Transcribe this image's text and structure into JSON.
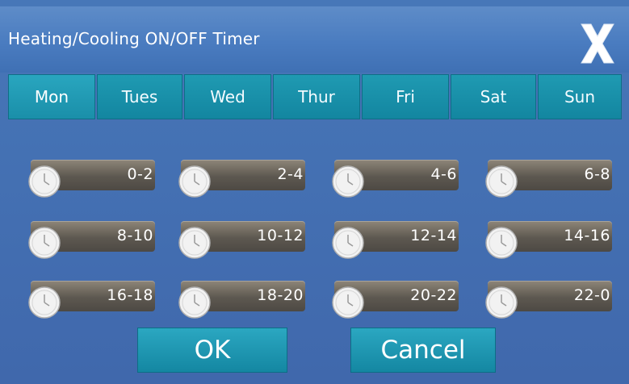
{
  "window": {
    "title": "Heating/Cooling ON/OFF Timer",
    "close_icon": "close-x-icon"
  },
  "days": [
    {
      "label": "Mon",
      "active": true
    },
    {
      "label": "Tues",
      "active": false
    },
    {
      "label": "Wed",
      "active": false
    },
    {
      "label": "Thur",
      "active": false
    },
    {
      "label": "Fri",
      "active": false
    },
    {
      "label": "Sat",
      "active": false
    },
    {
      "label": "Sun",
      "active": false
    }
  ],
  "slots": [
    {
      "label": "0-2",
      "state": "off"
    },
    {
      "label": "2-4",
      "state": "off"
    },
    {
      "label": "4-6",
      "state": "off"
    },
    {
      "label": "6-8",
      "state": "off"
    },
    {
      "label": "8-10",
      "state": "off"
    },
    {
      "label": "10-12",
      "state": "off"
    },
    {
      "label": "12-14",
      "state": "off"
    },
    {
      "label": "14-16",
      "state": "off"
    },
    {
      "label": "16-18",
      "state": "off"
    },
    {
      "label": "18-20",
      "state": "off"
    },
    {
      "label": "20-22",
      "state": "off"
    },
    {
      "label": "22-0",
      "state": "off"
    }
  ],
  "buttons": {
    "ok_label": "OK",
    "cancel_label": "Cancel"
  },
  "colors": {
    "background": "#4470b2",
    "tab": "#1a8fa9",
    "slot_bar": "#5d5850",
    "text": "#ffffff"
  }
}
